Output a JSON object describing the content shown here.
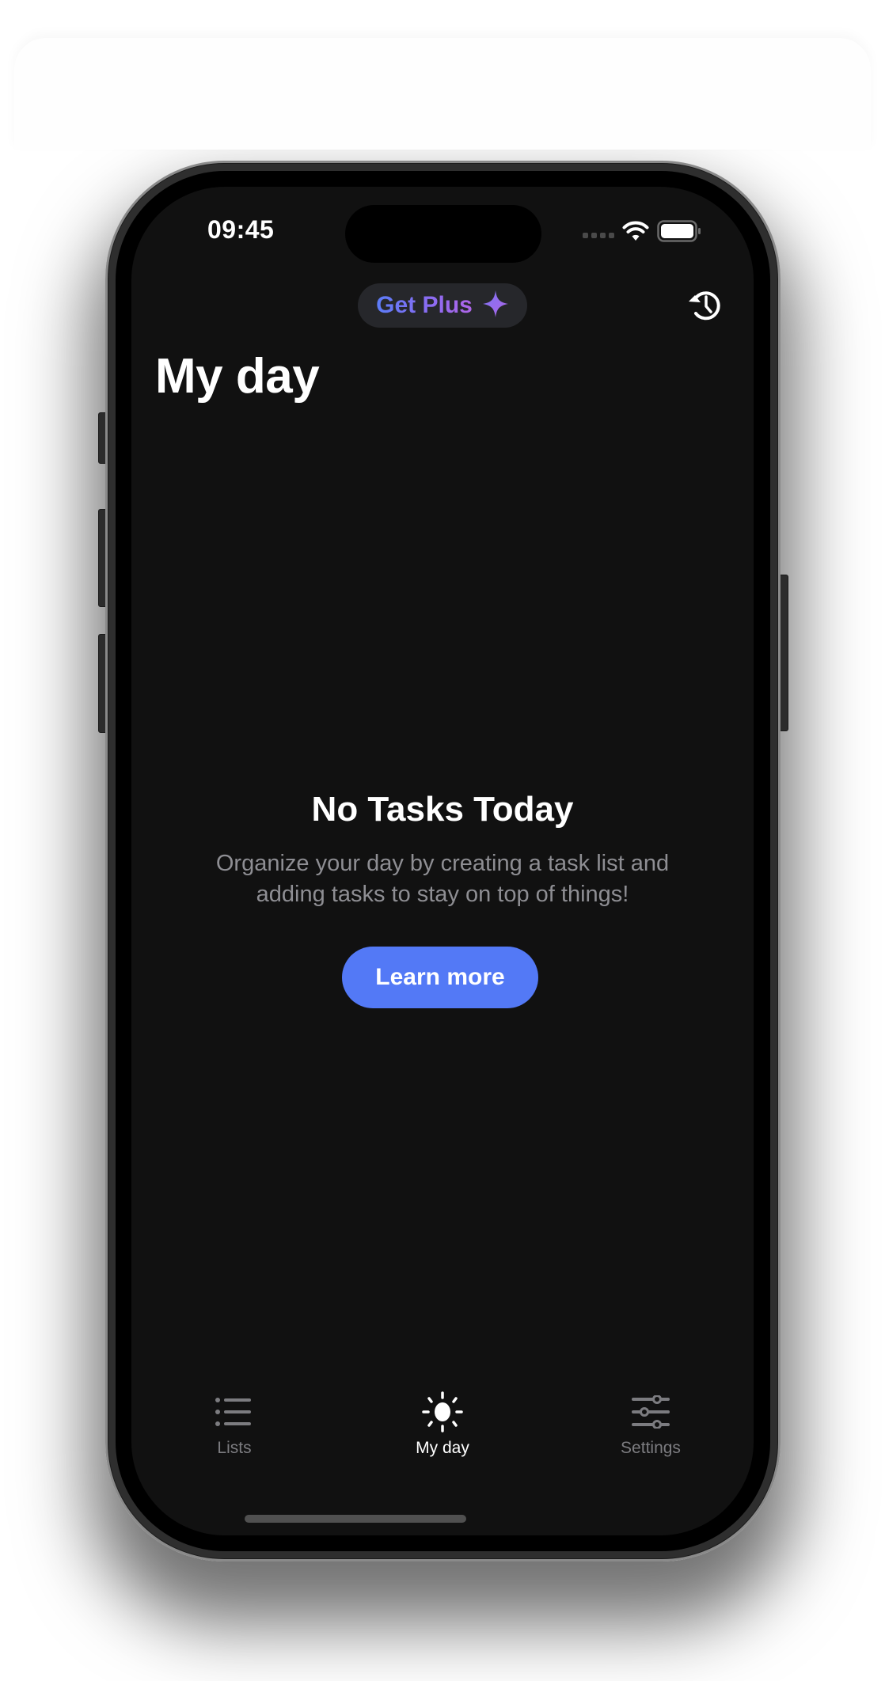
{
  "status_bar": {
    "time": "09:45",
    "icons": [
      "cellular-signal-icon",
      "wifi-icon",
      "battery-icon"
    ]
  },
  "header": {
    "get_plus_label": "Get Plus",
    "get_plus_icon": "sparkle-icon",
    "history_icon": "history-icon",
    "title": "My day"
  },
  "empty_state": {
    "title": "No Tasks Today",
    "description": "Organize your day by creating a task list and adding tasks to stay on top of things!",
    "button_label": "Learn more"
  },
  "tab_bar": {
    "tabs": [
      {
        "label": "Lists",
        "icon": "list-icon",
        "active": false
      },
      {
        "label": "My day",
        "icon": "sun-icon",
        "active": true
      },
      {
        "label": "Settings",
        "icon": "sliders-icon",
        "active": false
      }
    ]
  },
  "colors": {
    "screen_background": "#111111",
    "accent": "#5379f6",
    "plus_gradient_start": "#5b7cf7",
    "plus_gradient_end": "#b065e8",
    "secondary_text": "#8e8e93",
    "inactive_tab": "#7c7c80"
  }
}
